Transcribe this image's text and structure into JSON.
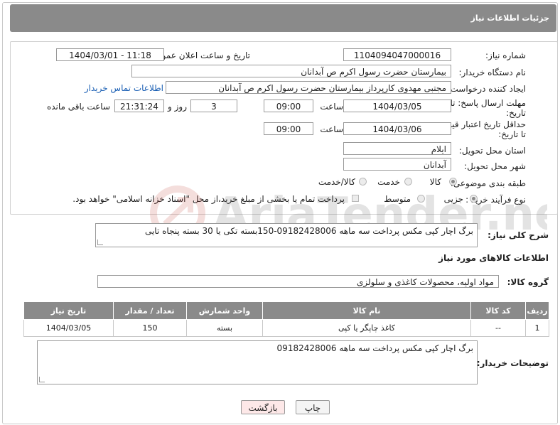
{
  "header": {
    "title": "جزئیات اطلاعات نیاز"
  },
  "form": {
    "need_number_label": "شماره نیاز:",
    "need_number": "1104094047000016",
    "announce_label": "تاریخ و ساعت اعلان عمومی:",
    "announce_value": "1404/03/01 - 11:18",
    "buyer_org_label": "نام دستگاه خریدار:",
    "buyer_org": "بیمارستان حضرت رسول اکرم  ص  آبدانان",
    "creator_label": "ایجاد کننده درخواست:",
    "creator": "مجتبی مهدوی کارپرداز بیمارستان حضرت رسول اکرم  ص  آبدانان",
    "contact_link": "اطلاعات تماس خریدار",
    "reply_deadline_label_1": "مهلت ارسال پاسخ: تا",
    "reply_deadline_label_2": "تاریخ:",
    "reply_date": "1404/03/05",
    "time_label": "ساعت",
    "reply_time": "09:00",
    "days_value": "3",
    "days_label": "روز و",
    "remaining_time": "21:31:24",
    "remaining_label": "ساعت باقی مانده",
    "price_validity_label_1": "حداقل تاریخ اعتبار قیمت:",
    "price_validity_label_2": "تا تاریخ:",
    "price_date": "1404/03/06",
    "price_time": "09:00",
    "province_label": "استان محل تحویل:",
    "province": "ایلام",
    "city_label": "شهر محل تحویل:",
    "city": "آبدانان",
    "category_label": "طبقه بندی موضوعی:",
    "category_options": [
      "کالا",
      "خدمت",
      "کالا/خدمت"
    ],
    "category_selected": "کالا",
    "process_label": "نوع فرآیند خرید :",
    "process_options": [
      "جزیی",
      "متوسط"
    ],
    "process_selected": "جزیی",
    "treasury_note": "پرداخت تمام یا بخشی از مبلغ خرید،از محل \"اسناد خزانه اسلامی\" خواهد بود."
  },
  "description": {
    "label": "شرح کلی نیاز:",
    "text": "برگ اچار کپی مکس پرداخت سه ماهه 09182428006-150بسته تکی یا 30 بسته پنجاه تایی"
  },
  "goods_info_title": "اطلاعات کالاهای مورد نیاز",
  "goods_group": {
    "label": "گروه کالا:",
    "value": "مواد اولیه، محصولات کاغذی و سلولزی"
  },
  "table": {
    "headers": [
      "ردیف",
      "کد کالا",
      "نام کالا",
      "واحد شمارش",
      "تعداد / مقدار",
      "تاریخ نیاز"
    ],
    "rows": [
      [
        "1",
        "--",
        "کاغذ چاپگر یا کپی",
        "بسته",
        "150",
        "1404/03/05"
      ]
    ]
  },
  "buyer_notes": {
    "label": "توضیحات خریدار:",
    "text": "برگ اچار کپی مکس پرداخت سه ماهه 09182428006"
  },
  "buttons": {
    "print": "چاپ",
    "back": "بازگشت"
  },
  "colors": {
    "header_bg": "#8a8a8a",
    "link": "#1a5fb4",
    "back_button_bg": "#fde8e8"
  }
}
